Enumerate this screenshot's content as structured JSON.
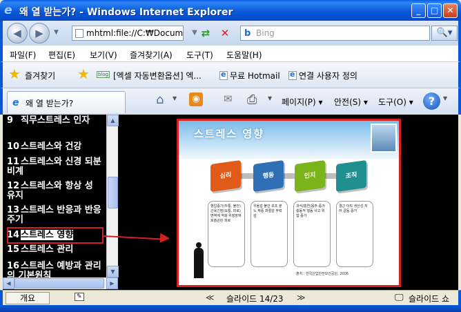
{
  "window": {
    "title": "왜 열 받는가? - Windows Internet Explorer",
    "minimize": "_",
    "maximize": "□",
    "close": "✕"
  },
  "address": {
    "back": "◀",
    "forward": "▶",
    "url": "mhtml:file://C:₩Docum",
    "refresh_icon": "refresh-icon",
    "stop": "✕",
    "search_placeholder": "Bing",
    "search_logo": "b",
    "search_button": "🔍▾"
  },
  "menu": {
    "items": [
      "파일(F)",
      "편집(E)",
      "보기(V)",
      "즐겨찾기(A)",
      "도구(T)",
      "도움말(H)"
    ]
  },
  "favorites": {
    "label": "즐겨찾기",
    "links": [
      "[엑셀 자동변환옵션] 엑...",
      "무료 Hotmail",
      "연결 사용자 정의"
    ],
    "blog_badge": "blog"
  },
  "tabbar": {
    "tab_title": "왜 열 받는가?",
    "page_menu": "페이지(P) ▾",
    "safety_menu": "안전(S) ▾",
    "tools_menu": "도구(O) ▾",
    "help": "?"
  },
  "outline": {
    "items": [
      {
        "num": "9",
        "text": "직무스트레스 인자"
      },
      {
        "num": "10",
        "text": "스트레스와 건강"
      },
      {
        "num": "11",
        "text": "스트레스와 신경 되분비계"
      },
      {
        "num": "12",
        "text": "스트레스와 항상 성 유지"
      },
      {
        "num": "13",
        "text": "스트레스 반응과 반응주기"
      },
      {
        "num": "14",
        "text": "스트레스 영향"
      },
      {
        "num": "15",
        "text": "스트레스 관리"
      },
      {
        "num": "16",
        "text": "스트레스 예방과 관리의 기본원칙"
      }
    ],
    "selected_index": 5
  },
  "slide": {
    "title": "스트레스 영향",
    "cubes": [
      "심리",
      "행동",
      "인지",
      "조직"
    ],
    "cube_colors": [
      "#e05a1a",
      "#2f6fb5",
      "#7bb31a",
      "#1f8f8f"
    ],
    "boxes": [
      "혈압증가(두통, 불안) 근육긴장(요통, 피로) 면역계 약화 위장장애 호흡곤란 피로",
      "우울감 불안 초조 분노 짜증 좌절감 무력감",
      "과식/흡연/음주 증가 충동적 행동 사고 위험 증가",
      "결근 이직 생산성 저하 갈등 증가"
    ],
    "source": "출처 : 한국산업안전보건공단, 2006"
  },
  "slide_nav": {
    "outline_button": "개요",
    "prev": "≪",
    "counter": "슬라이드 14/23",
    "next": "≫",
    "slideshow": "슬라이드 쇼"
  }
}
